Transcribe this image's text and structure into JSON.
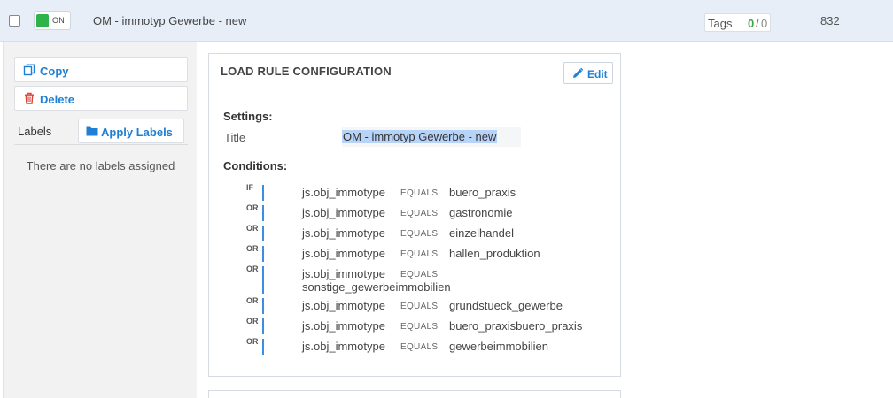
{
  "header": {
    "toggle_label": "ON",
    "toggle_color": "#2db34a",
    "rule_title": "OM - immotyp Gewerbe - new",
    "tags_label": "Tags",
    "tags_active": "0",
    "tags_separator": "/",
    "tags_total": "0",
    "rule_id": "832"
  },
  "sidebar": {
    "copy_label": "Copy",
    "copy_icon": "copy-icon",
    "delete_label": "Delete",
    "delete_icon": "trash-icon",
    "labels_heading": "Labels",
    "apply_labels_label": "Apply Labels",
    "apply_labels_icon": "folder-icon",
    "empty_text": "There are no labels assigned"
  },
  "card": {
    "title": "LOAD RULE CONFIGURATION",
    "edit_label": "Edit",
    "edit_icon": "pencil-icon",
    "settings_heading": "Settings:",
    "title_field_label": "Title",
    "title_field_value": "OM - immotyp Gewerbe - new",
    "conditions_heading": "Conditions:",
    "conditions": [
      {
        "op": "IF",
        "variable": "js.obj_immotype",
        "operator": "EQUALS",
        "value": "buero_praxis"
      },
      {
        "op": "OR",
        "variable": "js.obj_immotype",
        "operator": "EQUALS",
        "value": "gastronomie"
      },
      {
        "op": "OR",
        "variable": "js.obj_immotype",
        "operator": "EQUALS",
        "value": "einzelhandel"
      },
      {
        "op": "OR",
        "variable": "js.obj_immotype",
        "operator": "EQUALS",
        "value": "hallen_produktion"
      },
      {
        "op": "OR",
        "variable": "js.obj_immotype",
        "operator": "EQUALS",
        "value": "sonstige_gewerbeimmobilien"
      },
      {
        "op": "OR",
        "variable": "js.obj_immotype",
        "operator": "EQUALS",
        "value": "grundstueck_gewerbe"
      },
      {
        "op": "OR",
        "variable": "js.obj_immotype",
        "operator": "EQUALS",
        "value": "buero_praxisbuero_praxis"
      },
      {
        "op": "OR",
        "variable": "js.obj_immotype",
        "operator": "EQUALS",
        "value": "gewerbeimmobilien"
      }
    ]
  },
  "colors": {
    "link_blue": "#1f7fd4",
    "delete_red": "#d9453a",
    "condition_bar": "#3b8fe0",
    "selection": "#b7d3f7"
  }
}
